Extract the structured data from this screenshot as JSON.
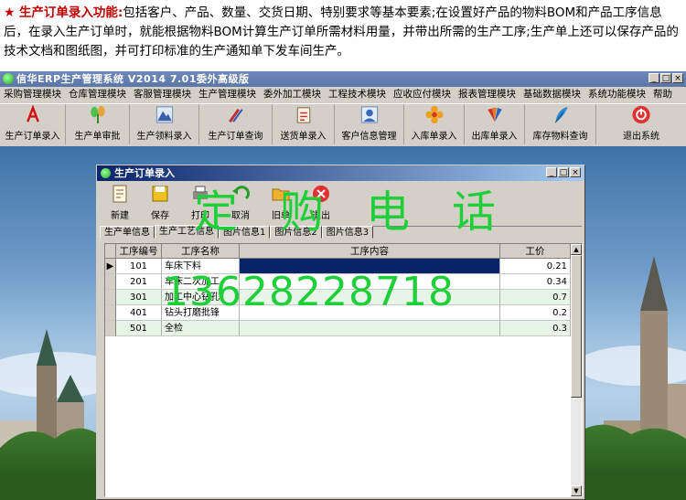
{
  "description": {
    "star": "★",
    "lead": "生产订单录入功能:",
    "text": "包括客户、产品、数量、交货日期、特别要求等基本要素;在设置好产品的物料BOM和产品工序信息后，在录入生产订单时，就能根据物料BOM计算生产订单所需材料用量，并带出所需的生产工序;生产单上还可以保存产品的技术文档和图纸图，并可打印标准的生产通知单下发车间生产。"
  },
  "app": {
    "title": "信华ERP生产管理系统   V2014   7.01委外高级版",
    "menu": [
      "采购管理模块",
      "仓库管理模块",
      "客服管理模块",
      "生产管理模块",
      "委外加工模块",
      "工程技术模块",
      "应收应付模块",
      "报表管理模块",
      "基础数据模块",
      "系统功能模块",
      "帮助"
    ],
    "toolbar": [
      "生产订单录入",
      "生产单审批",
      "生产领料录入",
      "生产订单查询",
      "送货单录入",
      "客户信息管理",
      "入库单录入",
      "出库单录入",
      "库存物料查询",
      "退出系统"
    ],
    "window_buttons": [
      "_",
      "□",
      "×"
    ]
  },
  "child": {
    "title": "生产订单录入",
    "buttons": [
      "新建",
      "保存",
      "打印",
      "取消",
      "旧单",
      "退出"
    ],
    "tabs": [
      "生产单信息",
      "生产工艺信息",
      "图片信息1",
      "图片信息2",
      "图片信息3"
    ],
    "columns": [
      "工序编号",
      "工序名称",
      "工序内容",
      "工价"
    ],
    "rows": [
      {
        "no": "101",
        "name": "车床下料",
        "content": "",
        "price": "0.21"
      },
      {
        "no": "201",
        "name": "车床二次加工",
        "content": "",
        "price": "0.34"
      },
      {
        "no": "301",
        "name": "加工中心钻孔",
        "content": "",
        "price": "0.7"
      },
      {
        "no": "401",
        "name": "钻头打磨批锋",
        "content": "",
        "price": "0.2"
      },
      {
        "no": "501",
        "name": "全检",
        "content": "",
        "price": "0.3"
      }
    ]
  },
  "watermark": {
    "line1": "定购电话",
    "line2": "13628228718"
  },
  "colors": {
    "accent_red": "#c00000",
    "watermark_green": "#1fcf3a",
    "selected_cell": "#0a246a"
  }
}
